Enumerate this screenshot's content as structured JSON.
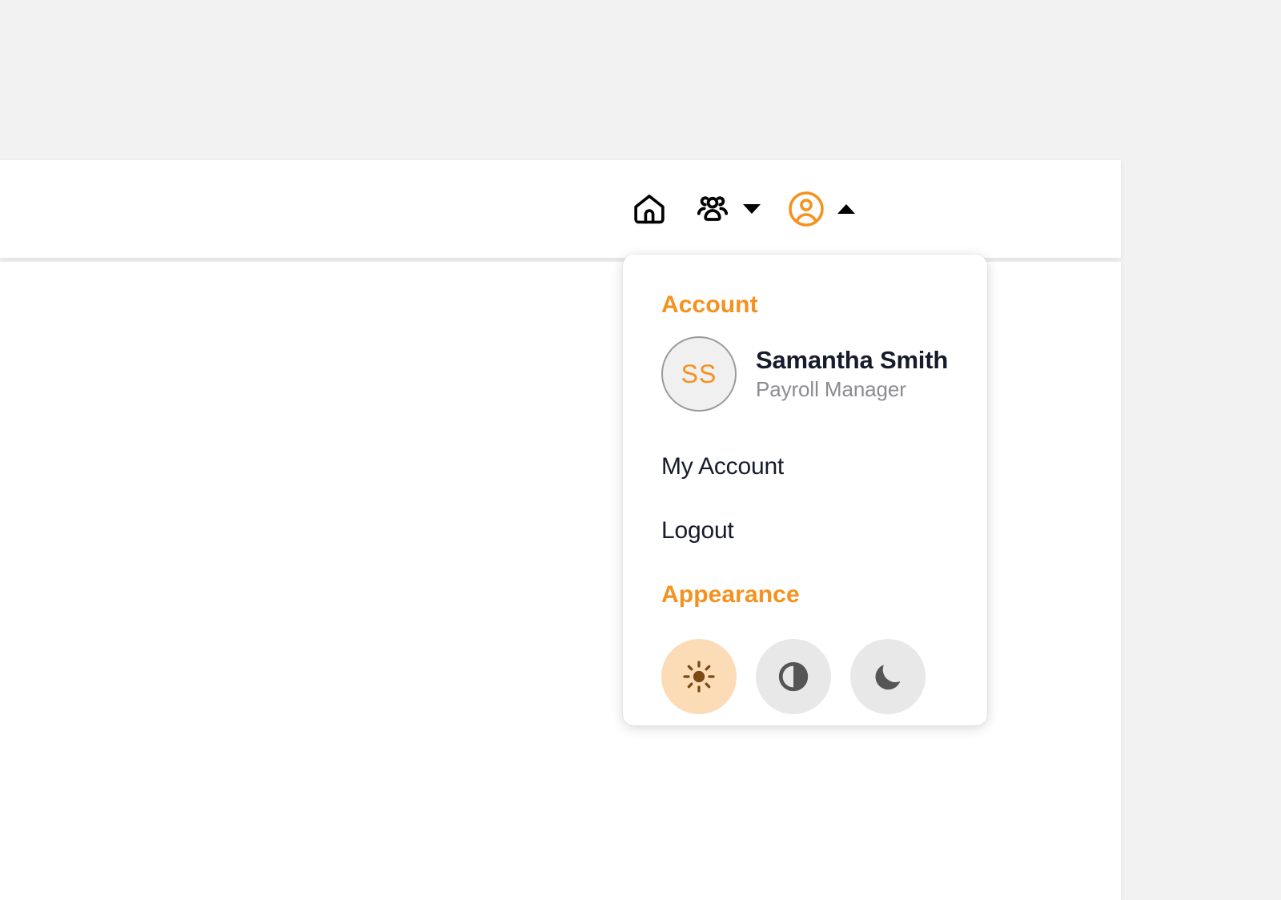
{
  "theme": {
    "page_background": "#f2f2f2",
    "surface": "#ffffff",
    "accent": "#f5911e",
    "text_primary": "#161c2b",
    "text_muted": "#8b8b92",
    "avatar_background": "#f0f0f0",
    "avatar_border": "#9a9a9a",
    "theme_button_background": "#e8e8e8",
    "theme_button_active_background": "#fbdcb7",
    "sun_icon_color": "#7a4a15",
    "theme_icon_color": "#555555"
  },
  "header": {
    "home_button": {
      "label": "Home",
      "icon": "home-icon"
    },
    "people_button": {
      "label": "People",
      "icon": "users-group-icon",
      "caret": "chevron-down-icon",
      "expanded": false
    },
    "account_button": {
      "label": "Account",
      "icon": "user-circle-icon",
      "caret": "chevron-up-icon",
      "expanded": true
    }
  },
  "account_menu": {
    "account_section_title": "Account",
    "profile": {
      "initials": "SS",
      "name": "Samantha Smith",
      "role": "Payroll Manager"
    },
    "links": [
      {
        "label": "My Account"
      },
      {
        "label": "Logout"
      }
    ],
    "appearance_section_title": "Appearance",
    "appearance_options": [
      {
        "name": "light",
        "icon": "sun-icon",
        "selected": true
      },
      {
        "name": "system",
        "icon": "contrast-icon",
        "selected": false
      },
      {
        "name": "dark",
        "icon": "moon-icon",
        "selected": false
      }
    ]
  }
}
